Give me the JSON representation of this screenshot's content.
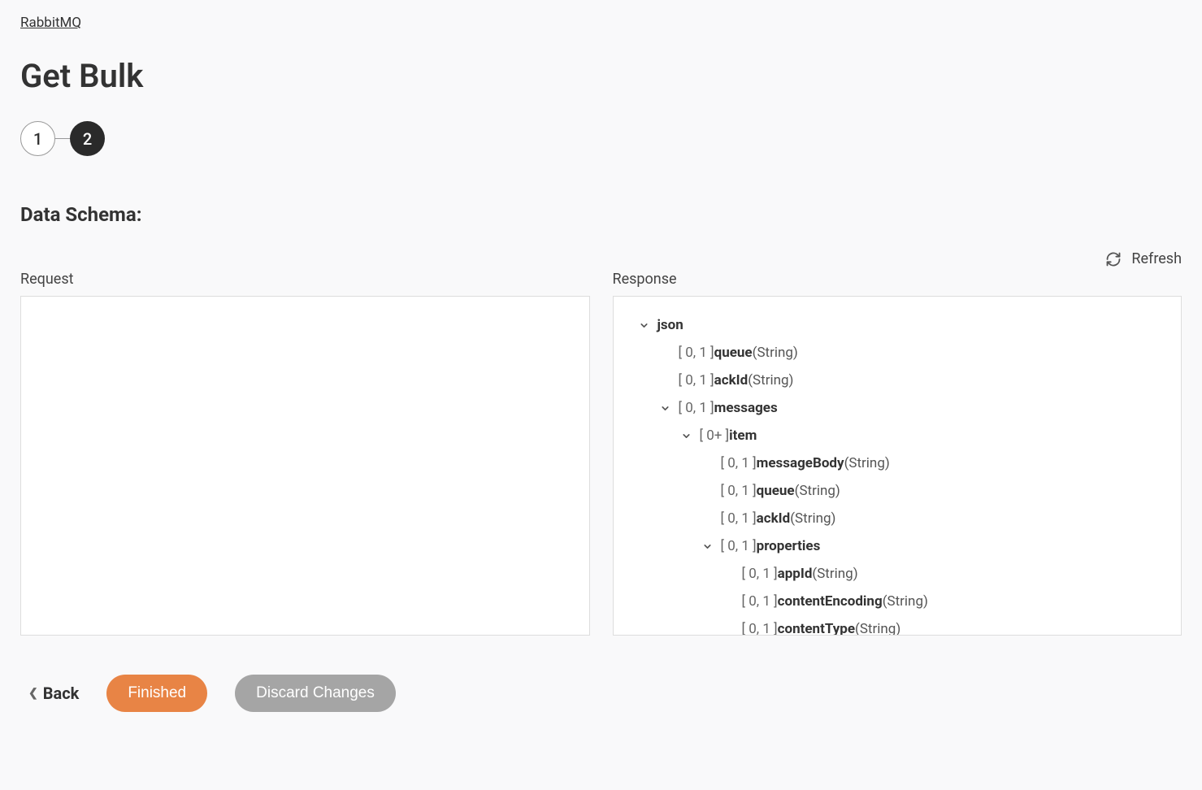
{
  "breadcrumb": {
    "label": "RabbitMQ"
  },
  "title": "Get Bulk",
  "stepper": {
    "steps": [
      "1",
      "2"
    ],
    "active_index": 1
  },
  "section_heading": "Data Schema:",
  "refresh_label": "Refresh",
  "panels": {
    "request_label": "Request",
    "response_label": "Response"
  },
  "response_tree": [
    {
      "indent": 0,
      "expandable": true,
      "name": "json",
      "card": "",
      "type": ""
    },
    {
      "indent": 1,
      "expandable": false,
      "name": "queue",
      "card": "[ 0, 1 ]",
      "type": "(String)"
    },
    {
      "indent": 1,
      "expandable": false,
      "name": "ackId",
      "card": "[ 0, 1 ]",
      "type": "(String)"
    },
    {
      "indent": 1,
      "expandable": true,
      "name": "messages",
      "card": "[ 0, 1 ]",
      "type": ""
    },
    {
      "indent": 2,
      "expandable": true,
      "name": "item",
      "card": "[ 0+ ]",
      "type": ""
    },
    {
      "indent": 3,
      "expandable": false,
      "name": "messageBody",
      "card": "[ 0, 1 ]",
      "type": "(String)"
    },
    {
      "indent": 3,
      "expandable": false,
      "name": "queue",
      "card": "[ 0, 1 ]",
      "type": "(String)"
    },
    {
      "indent": 3,
      "expandable": false,
      "name": "ackId",
      "card": "[ 0, 1 ]",
      "type": "(String)"
    },
    {
      "indent": 3,
      "expandable": true,
      "name": "properties",
      "card": "[ 0, 1 ]",
      "type": ""
    },
    {
      "indent": 4,
      "expandable": false,
      "name": "appId",
      "card": "[ 0, 1 ]",
      "type": "(String)"
    },
    {
      "indent": 4,
      "expandable": false,
      "name": "contentEncoding",
      "card": "[ 0, 1 ]",
      "type": "(String)"
    },
    {
      "indent": 4,
      "expandable": false,
      "name": "contentType",
      "card": "[ 0, 1 ]",
      "type": "(String)"
    }
  ],
  "footer": {
    "back_label": "Back",
    "finished_label": "Finished",
    "discard_label": "Discard Changes"
  },
  "colors": {
    "accent": "#e88445",
    "step_active": "#2a2a2a"
  }
}
